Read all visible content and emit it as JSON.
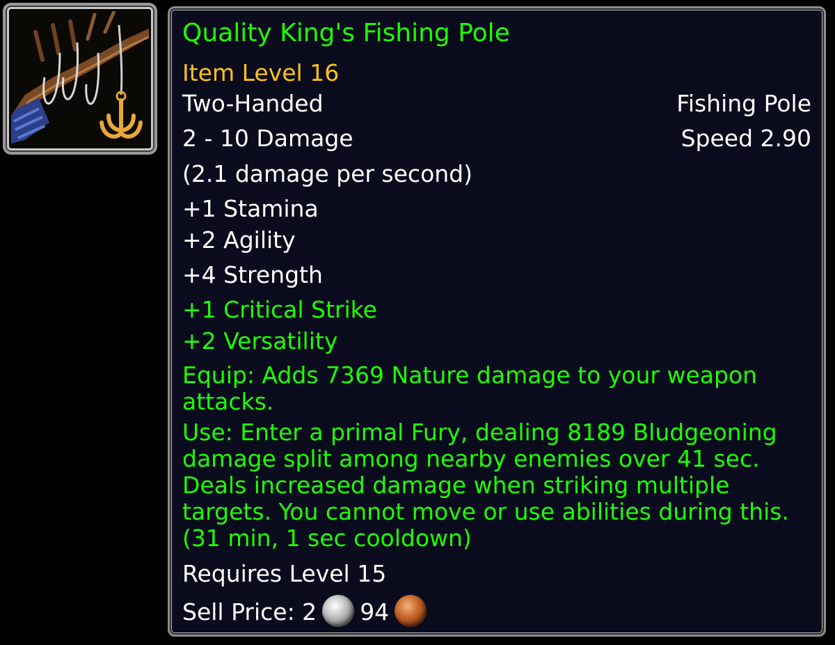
{
  "item": {
    "name": "Quality King's Fishing Pole",
    "item_level": "Item Level 16",
    "slot": "Two-Handed",
    "type": "Fishing Pole",
    "damage": "2 - 10 Damage",
    "speed": "Speed 2.90",
    "dps": "(2.1 damage per second)",
    "stats": [
      "+1 Stamina",
      "+2 Agility",
      "+4 Strength"
    ],
    "secondary_stats": [
      "+1 Critical Strike",
      "+2 Versatility"
    ],
    "equip_effect": "Equip: Adds 7369 Nature damage to your weapon attacks.",
    "use_effect": "Use: Enter a primal Fury, dealing 8189 Bludgeoning damage split among nearby enemies over 41 sec. Deals increased damage when striking multiple targets. You cannot move or use abilities during this. (31 min, 1 sec cooldown)",
    "requirement": "Requires Level 15",
    "sell_price_label": "Sell Price: 2",
    "sell_price_copper": "94",
    "icon": "fishing-pole-icon"
  },
  "colors": {
    "item_name": "#1eff00",
    "item_level": "#ffc315",
    "text": "#ffffff",
    "bonus": "#1eff00",
    "background": "#0a0c1e"
  },
  "coins": [
    "silver-coin-icon",
    "copper-coin-icon"
  ]
}
